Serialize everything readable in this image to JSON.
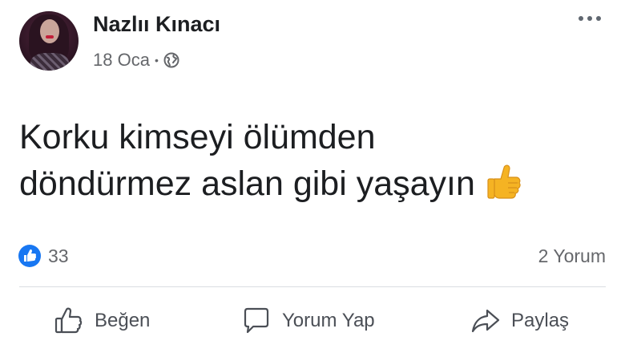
{
  "post": {
    "author": "Nazlıı Kınacı",
    "date": "18 Oca",
    "separator": "•",
    "privacy_icon": "globe-icon",
    "text_lines": [
      "Korku kimseyi ölümden",
      "döndürmez aslan gibi yaşayın"
    ],
    "emoji": "thumbs-up-emoji"
  },
  "reactions": {
    "count": "33",
    "icon": "like-reaction-icon",
    "comments": "2 Yorum"
  },
  "actions": {
    "like_label": "Beğen",
    "comment_label": "Yorum Yap",
    "share_label": "Paylaş"
  },
  "colors": {
    "text": "#1c1e21",
    "secondary": "#65676b",
    "like_blue": "#1877f2",
    "divider": "#dadde1",
    "emoji_yellow": "#f5b323"
  }
}
